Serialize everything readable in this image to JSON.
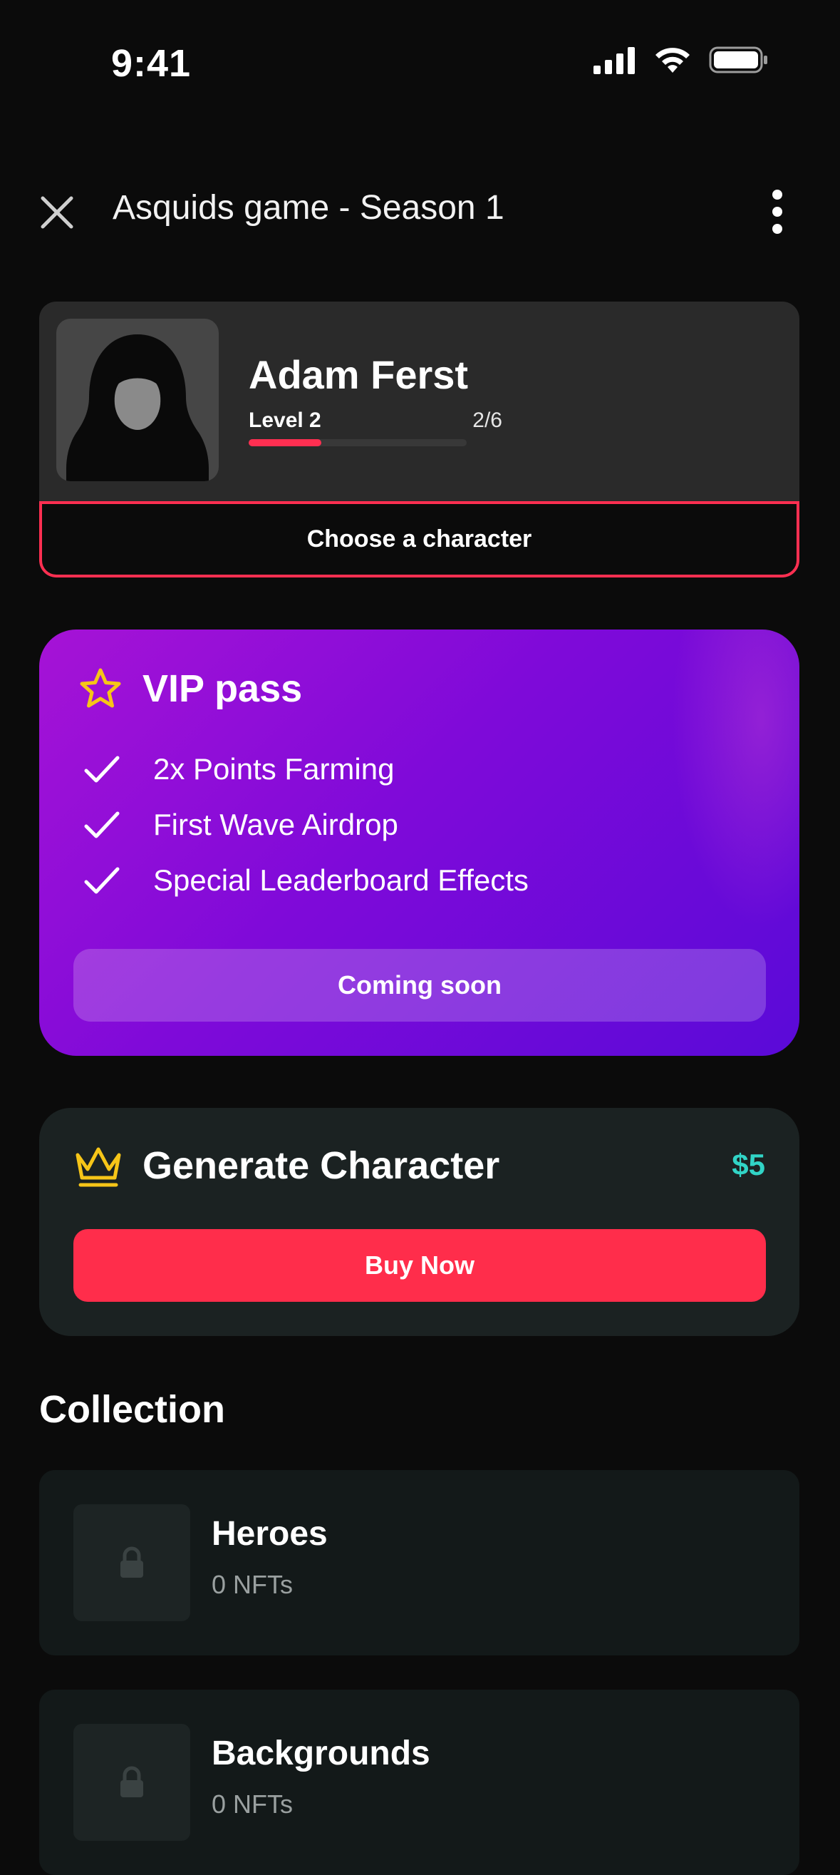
{
  "status_bar": {
    "time": "9:41"
  },
  "header": {
    "title": "Asquids game - Season 1"
  },
  "profile": {
    "name": "Adam Ferst",
    "level": "Level 2",
    "progress_text": "2/6",
    "progress_fraction": 0.333,
    "choose_label": "Choose a character"
  },
  "vip": {
    "title": "VIP pass",
    "benefits": [
      "2x Points Farming",
      "First Wave Airdrop",
      "Special Leaderboard Effects"
    ],
    "button_label": "Coming soon"
  },
  "generate": {
    "title": "Generate Character",
    "price": "$5",
    "button_label": "Buy Now"
  },
  "collection": {
    "title": "Collection",
    "items": [
      {
        "name": "Heroes",
        "count": "0 NFTs"
      },
      {
        "name": "Backgrounds",
        "count": "0 NFTs"
      }
    ]
  },
  "colors": {
    "accent_red": "#ff2f51",
    "price_teal": "#31d4c6",
    "gold": "#f6c518"
  }
}
